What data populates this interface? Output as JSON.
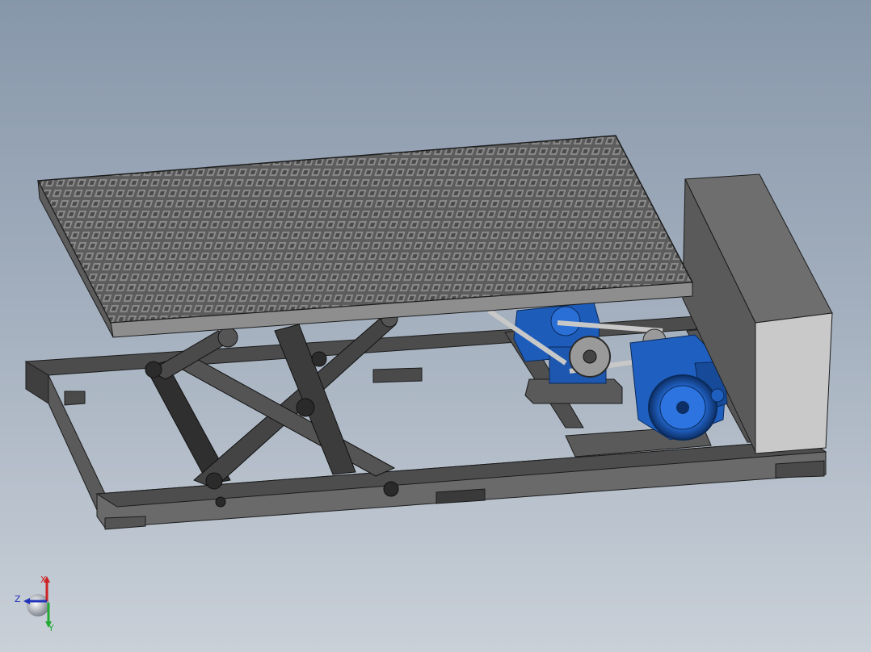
{
  "viewport": {
    "background_top": "#8797aa",
    "background_bottom": "#c9d0d8",
    "model": {
      "components": [
        "grating-platform",
        "scissor-lift-arms",
        "base-frame",
        "drive-motor",
        "gear-reducer",
        "belt-drive",
        "side-cabinet"
      ],
      "colors": {
        "steel": "#5f5f5f",
        "steel_dark": "#3a3a3a",
        "steel_light": "#8a8a8a",
        "grating": "#7a7a7a",
        "motor_blue": "#1f5fbf",
        "cabinet_front": "#c9c9c9",
        "cabinet_side": "#6e6e6e"
      }
    },
    "triad": {
      "x_label": "X",
      "y_label": "Y",
      "z_label": "Z",
      "x_color": "#cc2222",
      "y_color": "#22aa33",
      "z_color": "#2233bb"
    }
  }
}
